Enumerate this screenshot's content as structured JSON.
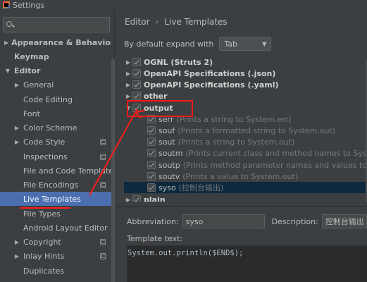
{
  "window": {
    "title": "Settings"
  },
  "sidebar": {
    "search_placeholder": "",
    "items": [
      {
        "label": "Appearance & Behavior",
        "bold": true,
        "arrow": "right"
      },
      {
        "label": "Keymap",
        "bold": true,
        "arrow": "none"
      },
      {
        "label": "Editor",
        "bold": true,
        "arrow": "down"
      },
      {
        "label": "General",
        "arrow": "right"
      },
      {
        "label": "Code Editing",
        "arrow": "none"
      },
      {
        "label": "Font",
        "arrow": "none"
      },
      {
        "label": "Color Scheme",
        "arrow": "right"
      },
      {
        "label": "Code Style",
        "arrow": "right"
      },
      {
        "label": "Inspections"
      },
      {
        "label": "File and Code Templates"
      },
      {
        "label": "File Encodings"
      },
      {
        "label": "Live Templates",
        "selected": true
      },
      {
        "label": "File Types"
      },
      {
        "label": "Android Layout Editor"
      },
      {
        "label": "Copyright",
        "arrow": "right"
      },
      {
        "label": "Inlay Hints",
        "arrow": "right"
      },
      {
        "label": "Duplicates"
      }
    ]
  },
  "main": {
    "breadcrumb": {
      "part1": "Editor",
      "part2": "Live Templates"
    },
    "expand": {
      "label": "By default expand with",
      "value": "Tab"
    },
    "groups": [
      {
        "label": "OGNL (Struts 2)"
      },
      {
        "label": "OpenAPI Specifications (.json)"
      },
      {
        "label": "OpenAPI Specifications (.yaml)"
      },
      {
        "label": "other"
      },
      {
        "label": "output"
      }
    ],
    "templates": [
      {
        "name": "serr",
        "desc": "(Prints a string to System.err)"
      },
      {
        "name": "souf",
        "desc": "(Prints a formatted string to System.out)"
      },
      {
        "name": "sout",
        "desc": "(Prints a string to System.out)"
      },
      {
        "name": "soutm",
        "desc": "(Prints current class and method names to System.out)"
      },
      {
        "name": "soutp",
        "desc": "(Prints method parameter names and values to System.out)"
      },
      {
        "name": "soutv",
        "desc": "(Prints a value to System.out)"
      },
      {
        "name": "syso",
        "desc": "(控制台输出)"
      }
    ],
    "last_group": {
      "label": "plain"
    },
    "abbreviation": {
      "label": "Abbreviation:",
      "value": "syso"
    },
    "description": {
      "label": "Description:",
      "value": "控制台输出"
    },
    "template_text": {
      "label": "Template text:",
      "value": "System.out.println($END$);"
    }
  }
}
